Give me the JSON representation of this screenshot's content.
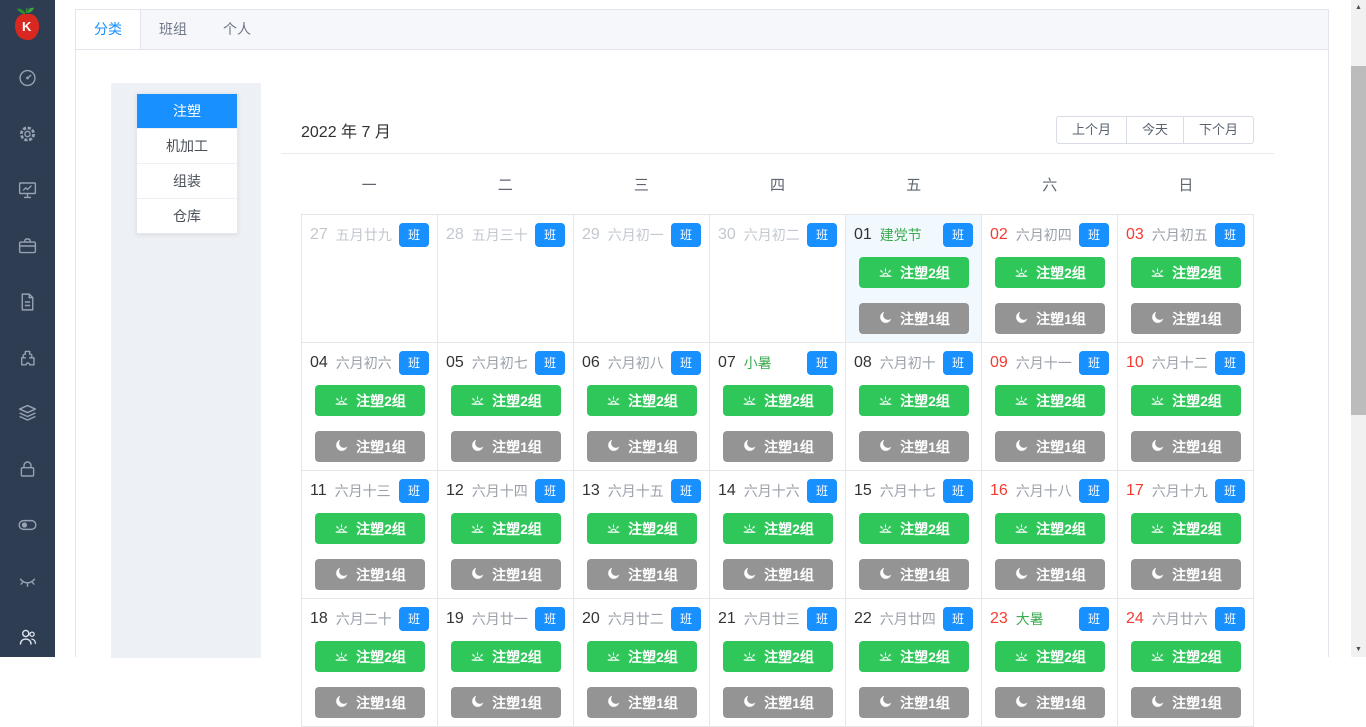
{
  "sidebar": {
    "logo": "strawberry-logo",
    "icons": [
      "dashboard",
      "gear",
      "monitor-chart",
      "briefcase",
      "document",
      "puzzle",
      "layers",
      "lock",
      "toggle",
      "eye-closed",
      "users"
    ]
  },
  "tabs": [
    {
      "key": "category",
      "label": "分类",
      "active": true
    },
    {
      "key": "team",
      "label": "班组",
      "active": false
    },
    {
      "key": "personal",
      "label": "个人",
      "active": false
    }
  ],
  "categories": [
    {
      "key": "injection-molding",
      "label": "注塑",
      "selected": true
    },
    {
      "key": "machining",
      "label": "机加工",
      "selected": false
    },
    {
      "key": "assembly",
      "label": "组装",
      "selected": false
    },
    {
      "key": "warehouse",
      "label": "仓库",
      "selected": false
    }
  ],
  "calendar": {
    "title": "2022 年 7 月",
    "nav": {
      "prev": "上个月",
      "today": "今天",
      "next": "下个月"
    },
    "weekdays": [
      "一",
      "二",
      "三",
      "四",
      "五",
      "六",
      "日"
    ],
    "badge_label": "班",
    "day_shift_label": "注塑2组",
    "night_shift_label": "注塑1组",
    "cells": [
      {
        "day": "27",
        "lunar": "五月廿九",
        "prev": true,
        "weekend": false,
        "festival": false,
        "today": false,
        "shifts": false
      },
      {
        "day": "28",
        "lunar": "五月三十",
        "prev": true,
        "weekend": false,
        "festival": false,
        "today": false,
        "shifts": false
      },
      {
        "day": "29",
        "lunar": "六月初一",
        "prev": true,
        "weekend": false,
        "festival": false,
        "today": false,
        "shifts": false
      },
      {
        "day": "30",
        "lunar": "六月初二",
        "prev": true,
        "weekend": false,
        "festival": false,
        "today": false,
        "shifts": false
      },
      {
        "day": "01",
        "lunar": "建党节",
        "prev": false,
        "weekend": false,
        "festival": true,
        "today": true,
        "shifts": true
      },
      {
        "day": "02",
        "lunar": "六月初四",
        "prev": false,
        "weekend": true,
        "festival": false,
        "today": false,
        "shifts": true
      },
      {
        "day": "03",
        "lunar": "六月初五",
        "prev": false,
        "weekend": true,
        "festival": false,
        "today": false,
        "shifts": true
      },
      {
        "day": "04",
        "lunar": "六月初六",
        "prev": false,
        "weekend": false,
        "festival": false,
        "today": false,
        "shifts": true
      },
      {
        "day": "05",
        "lunar": "六月初七",
        "prev": false,
        "weekend": false,
        "festival": false,
        "today": false,
        "shifts": true
      },
      {
        "day": "06",
        "lunar": "六月初八",
        "prev": false,
        "weekend": false,
        "festival": false,
        "today": false,
        "shifts": true
      },
      {
        "day": "07",
        "lunar": "小暑",
        "prev": false,
        "weekend": false,
        "festival": true,
        "today": false,
        "shifts": true
      },
      {
        "day": "08",
        "lunar": "六月初十",
        "prev": false,
        "weekend": false,
        "festival": false,
        "today": false,
        "shifts": true
      },
      {
        "day": "09",
        "lunar": "六月十一",
        "prev": false,
        "weekend": true,
        "festival": false,
        "today": false,
        "shifts": true
      },
      {
        "day": "10",
        "lunar": "六月十二",
        "prev": false,
        "weekend": true,
        "festival": false,
        "today": false,
        "shifts": true
      },
      {
        "day": "11",
        "lunar": "六月十三",
        "prev": false,
        "weekend": false,
        "festival": false,
        "today": false,
        "shifts": true
      },
      {
        "day": "12",
        "lunar": "六月十四",
        "prev": false,
        "weekend": false,
        "festival": false,
        "today": false,
        "shifts": true
      },
      {
        "day": "13",
        "lunar": "六月十五",
        "prev": false,
        "weekend": false,
        "festival": false,
        "today": false,
        "shifts": true
      },
      {
        "day": "14",
        "lunar": "六月十六",
        "prev": false,
        "weekend": false,
        "festival": false,
        "today": false,
        "shifts": true
      },
      {
        "day": "15",
        "lunar": "六月十七",
        "prev": false,
        "weekend": false,
        "festival": false,
        "today": false,
        "shifts": true
      },
      {
        "day": "16",
        "lunar": "六月十八",
        "prev": false,
        "weekend": true,
        "festival": false,
        "today": false,
        "shifts": true
      },
      {
        "day": "17",
        "lunar": "六月十九",
        "prev": false,
        "weekend": true,
        "festival": false,
        "today": false,
        "shifts": true
      },
      {
        "day": "18",
        "lunar": "六月二十",
        "prev": false,
        "weekend": false,
        "festival": false,
        "today": false,
        "shifts": true
      },
      {
        "day": "19",
        "lunar": "六月廿一",
        "prev": false,
        "weekend": false,
        "festival": false,
        "today": false,
        "shifts": true
      },
      {
        "day": "20",
        "lunar": "六月廿二",
        "prev": false,
        "weekend": false,
        "festival": false,
        "today": false,
        "shifts": true
      },
      {
        "day": "21",
        "lunar": "六月廿三",
        "prev": false,
        "weekend": false,
        "festival": false,
        "today": false,
        "shifts": true
      },
      {
        "day": "22",
        "lunar": "六月廿四",
        "prev": false,
        "weekend": false,
        "festival": false,
        "today": false,
        "shifts": true
      },
      {
        "day": "23",
        "lunar": "大暑",
        "prev": false,
        "weekend": true,
        "festival": true,
        "today": false,
        "shifts": true
      },
      {
        "day": "24",
        "lunar": "六月廿六",
        "prev": false,
        "weekend": true,
        "festival": false,
        "today": false,
        "shifts": true
      }
    ]
  },
  "colors": {
    "accent_blue": "#1890ff",
    "day_shift_green": "#2fc65a",
    "night_shift_gray": "#949494",
    "weekend_red": "#f53b31",
    "festival_green": "#3cab50",
    "sidebar_bg": "#2f3d52",
    "today_cell_bg": "#f2f9fe"
  }
}
